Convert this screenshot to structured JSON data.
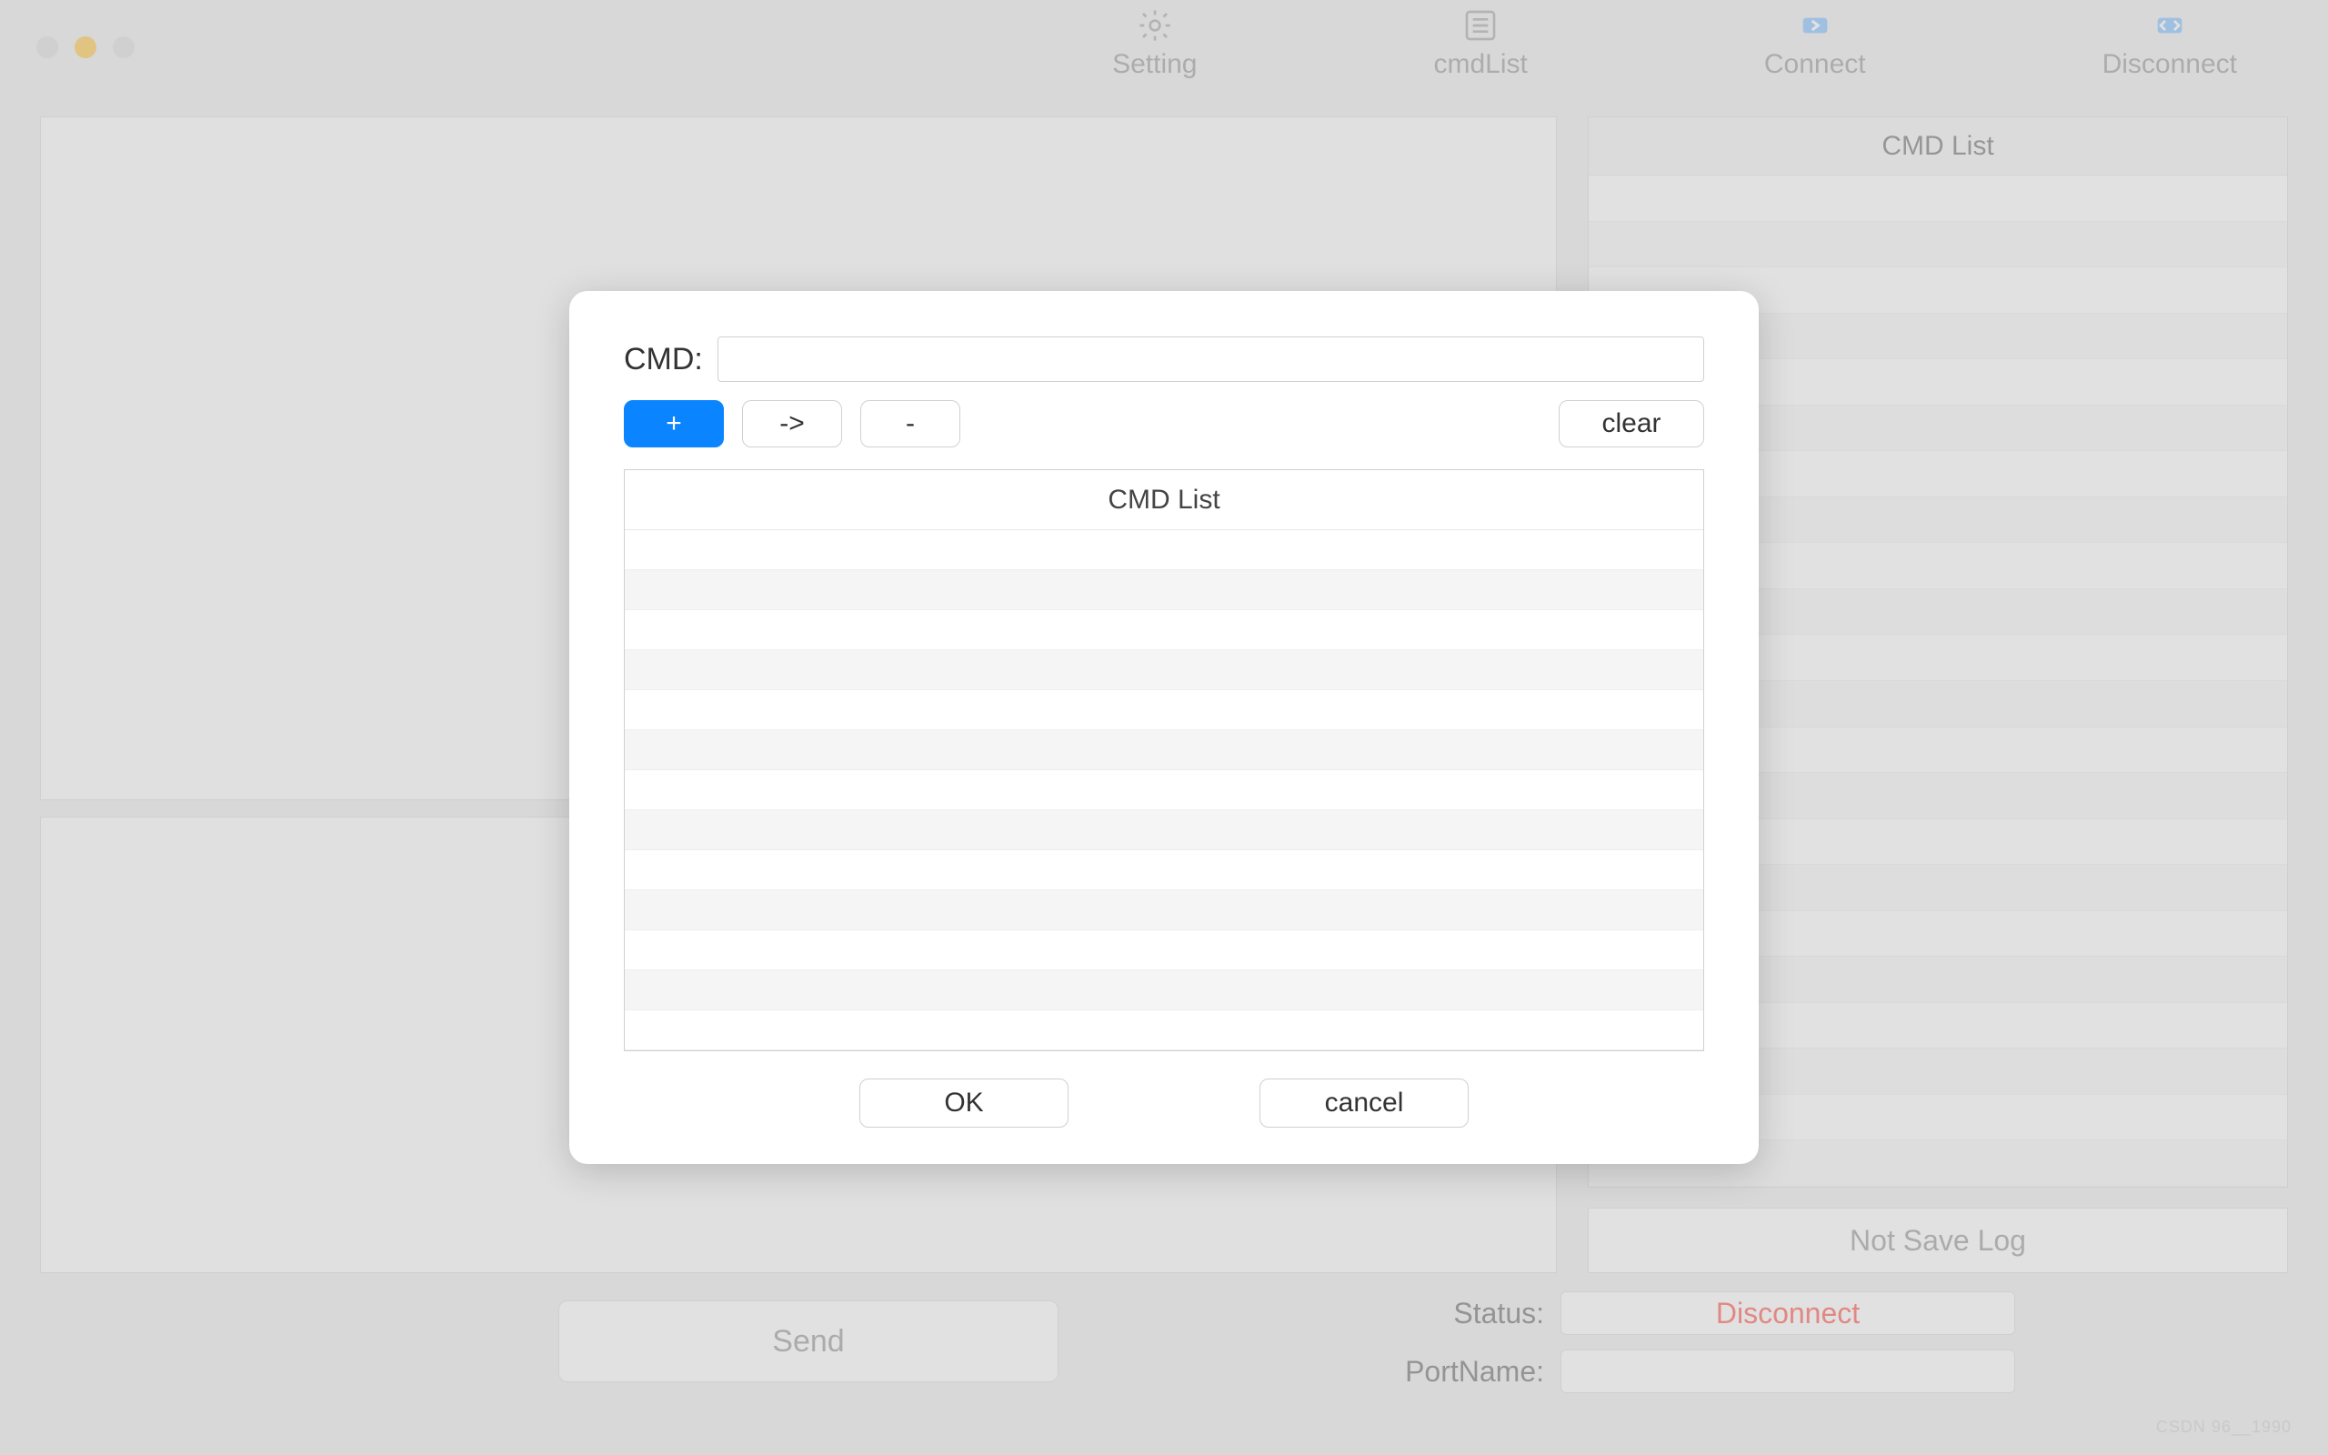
{
  "toolbar": {
    "setting": "Setting",
    "cmdlist": "cmdList",
    "connect": "Connect",
    "disconnect": "Disconnect"
  },
  "sidebar": {
    "cmd_list_header": "CMD List",
    "save_log_btn": "Not Save Log"
  },
  "bottom": {
    "send": "Send",
    "status_label": "Status:",
    "status_value": "Disconnect",
    "portname_label": "PortName:",
    "portname_value": ""
  },
  "modal": {
    "cmd_label": "CMD:",
    "cmd_value": "",
    "btn_add": "+",
    "btn_arrow": "->",
    "btn_minus": "-",
    "btn_clear": "clear",
    "list_header": "CMD List",
    "ok": "OK",
    "cancel": "cancel"
  },
  "watermark": "CSDN 96__1990"
}
